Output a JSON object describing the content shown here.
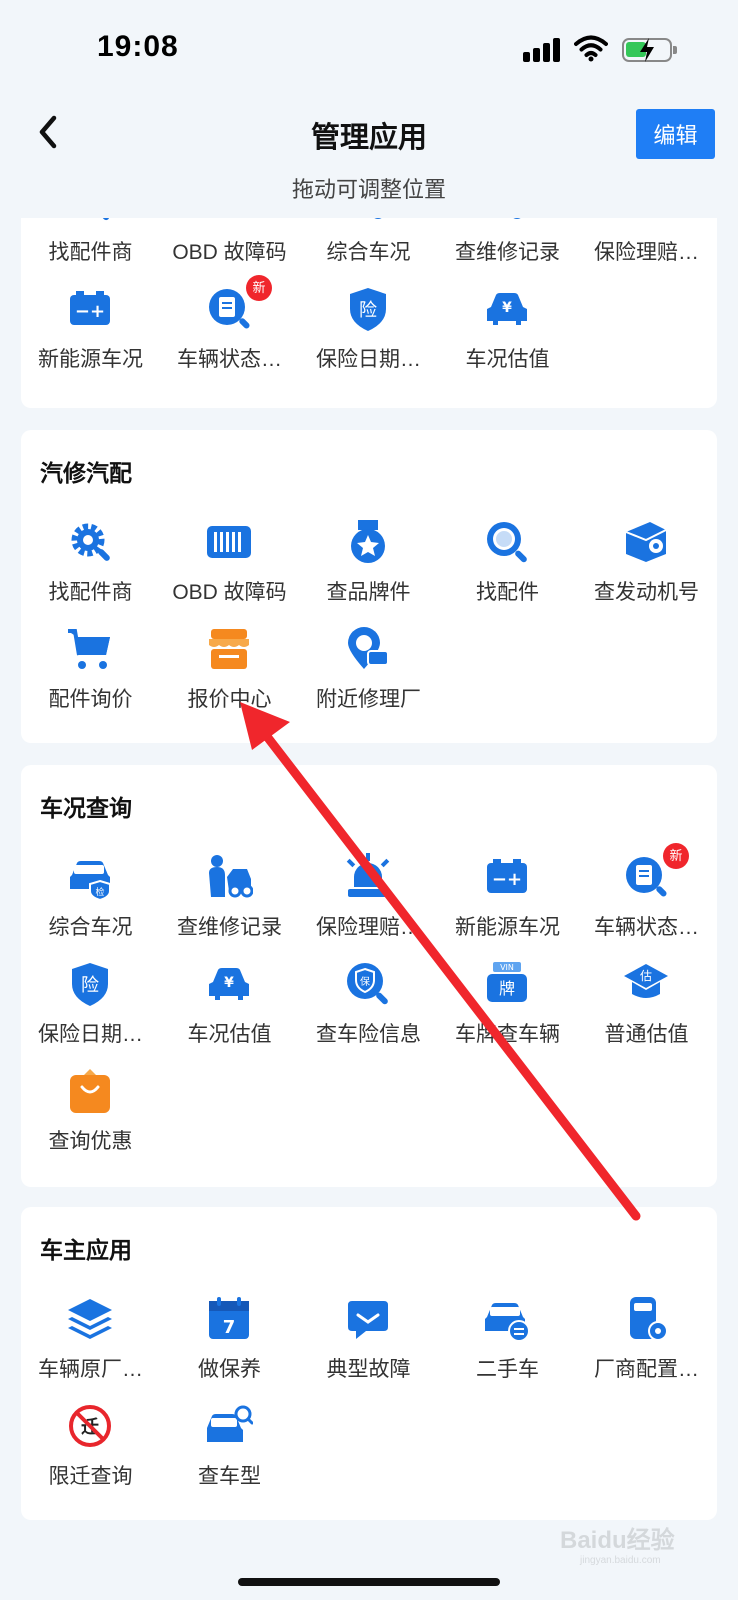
{
  "status": {
    "time": "19:08"
  },
  "nav": {
    "title": "管理应用",
    "edit": "编辑",
    "subtitle": "拖动可调整位置"
  },
  "top_section": {
    "row1": [
      "找配件商",
      "OBD 故障码",
      "综合车况",
      "查维修记录",
      "保险理赔…"
    ],
    "row2": [
      "新能源车况",
      "车辆状态…",
      "保险日期…",
      "车况估值"
    ],
    "badge": "新"
  },
  "sections": [
    {
      "title": "汽修汽配",
      "apps": [
        "找配件商",
        "OBD 故障码",
        "查品牌件",
        "找配件",
        "查发动机号",
        "配件询价",
        "报价中心",
        "附近修理厂"
      ]
    },
    {
      "title": "车况查询",
      "apps": [
        "综合车况",
        "查维修记录",
        "保险理赔…",
        "新能源车况",
        "车辆状态…",
        "保险日期…",
        "车况估值",
        "查车险信息",
        "车牌查车辆",
        "普通估值",
        "查询优惠"
      ],
      "badge": "新"
    },
    {
      "title": "车主应用",
      "apps": [
        "车辆原厂…",
        "做保养",
        "典型故障",
        "二手车",
        "厂商配置…",
        "限迁查询",
        "查车型"
      ]
    }
  ],
  "icon_glyphs": {
    "battery": "−+",
    "insurance": "险",
    "yen": "¥",
    "inspect": "检",
    "guarantee": "保",
    "plate": "牌",
    "vin": "VIN",
    "estimate": "估",
    "calendar": "7",
    "move": "迁"
  },
  "watermark": {
    "brand": "Baidu经验",
    "url": "jingyan.baidu.com"
  },
  "colors": {
    "accent": "#1f7ef5",
    "icon_blue": "#1a73e0",
    "badge": "#f0262c",
    "arrow": "#f0262c",
    "orange": "#f5891f"
  }
}
